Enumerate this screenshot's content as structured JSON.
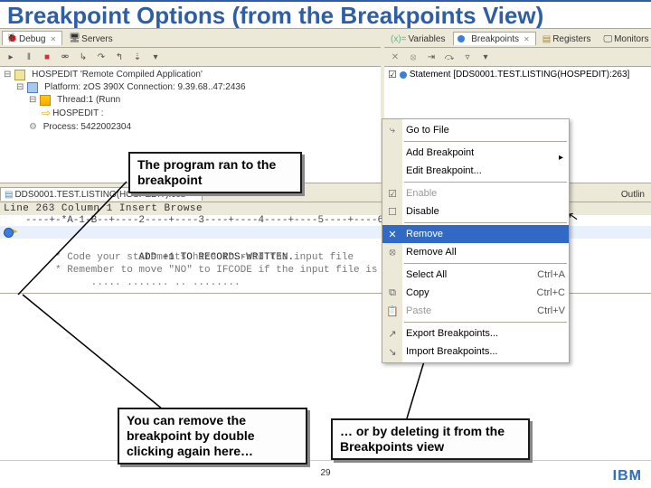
{
  "slide": {
    "title": "Breakpoint Options (from the Breakpoints View)",
    "page": "29"
  },
  "tabs_left": [
    {
      "label": "Debug",
      "active": true,
      "close": true
    },
    {
      "label": "Servers",
      "active": false
    }
  ],
  "tabs_right": [
    {
      "label": "Variables"
    },
    {
      "label": "Breakpoints",
      "active": true,
      "close": true
    },
    {
      "label": "Registers"
    },
    {
      "label": "Monitors"
    }
  ],
  "debug_tree": {
    "root": "HOSPEDIT 'Remote Compiled Application'",
    "platform": "Platform: zOS 390X   Connection: 9.39.68..47:2436",
    "thread": "Thread:1 (Runn",
    "frame": "HOSPEDIT :",
    "process": "Process: 5422002304"
  },
  "breakpoints": {
    "item": "Statement [DDS0001.TEST.LISTING(HOSPEDIT):263]"
  },
  "context_menu": {
    "items": [
      {
        "label": "Go to File",
        "icon": "goto",
        "sep_after": true
      },
      {
        "label": "Add Breakpoint",
        "submenu": true
      },
      {
        "label": "Edit Breakpoint...",
        "sep_after": true
      },
      {
        "label": "Enable",
        "disabled": true,
        "icon": "check"
      },
      {
        "label": "Disable",
        "icon": "uncheck",
        "sep_after": true
      },
      {
        "label": "Remove",
        "selected": true,
        "icon": "remove"
      },
      {
        "label": "Remove All",
        "icon": "removeall",
        "sep_after": true
      },
      {
        "label": "Select All",
        "hint": "Ctrl+A"
      },
      {
        "label": "Copy",
        "hint": "Ctrl+C",
        "icon": "copy"
      },
      {
        "label": "Paste",
        "hint": "Ctrl+V",
        "disabled": true,
        "icon": "paste",
        "sep_after": true
      },
      {
        "label": "Export Breakpoints...",
        "icon": "export"
      },
      {
        "label": "Import Breakpoints...",
        "icon": "import"
      }
    ]
  },
  "editor": {
    "tab": "DDS0001.TEST.LISTING(HOSPEDIT).cob",
    "right_tab": "Outlin",
    "status": " Line 263       Column 1         Insert                  Browse",
    "ruler": "----+-*A-1-B--+----2----+----3----+----4----+----5----+----6----+----7--",
    "lines": [
      {
        "n": "",
        "text": "           ADD +1 TO RECORDS-WRITTEN.",
        "bp": true,
        "current": true
      },
      {
        "n": "",
        "text": "",
        "muted": true
      },
      {
        "n": "",
        "text": "     * Code your statements here to read the input file",
        "muted": true
      },
      {
        "n": "",
        "text": "     * Remember to move \"NO\" to IFCODE if the input file is AT END",
        "muted": true
      },
      {
        "n": "",
        "text": "           ..... ....... .. ........",
        "muted": true
      }
    ]
  },
  "callouts": {
    "c1": "The program ran to the breakpoint",
    "c2": "You can remove the breakpoint by double clicking again here…",
    "c3": "… or by deleting it from the Breakpoints view"
  },
  "logo": "IBM"
}
